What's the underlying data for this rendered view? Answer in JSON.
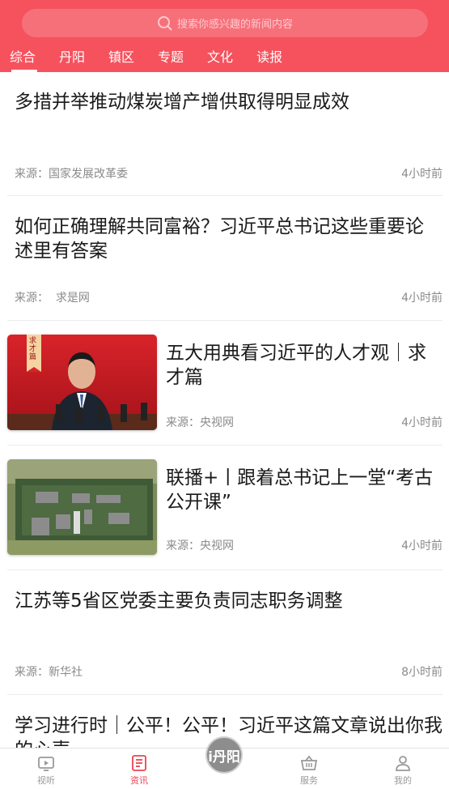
{
  "search": {
    "placeholder": "搜索你感兴趣的新闻内容"
  },
  "tabs": [
    {
      "label": "综合",
      "active": true
    },
    {
      "label": "丹阳"
    },
    {
      "label": "镇区"
    },
    {
      "label": "专题"
    },
    {
      "label": "文化"
    },
    {
      "label": "读报"
    }
  ],
  "articles": [
    {
      "title": "多措并举推动煤炭增产增供取得明显成效",
      "source": "来源：国家发展改革委",
      "time": "4小时前"
    },
    {
      "title": "如何正确理解共同富裕？习近平总书记这些重要论述里有答案",
      "source": "来源：  求是网",
      "time": "4小时前"
    },
    {
      "title": "五大用典看习近平的人才观｜求才篇",
      "source": "来源：央视网",
      "time": "4小时前",
      "thumb_caption": "求才篇"
    },
    {
      "title": "联播+丨跟着总书记上一堂“考古公开课”",
      "source": "来源：央视网",
      "time": "4小时前"
    },
    {
      "title": "江苏等5省区党委主要负责同志职务调整",
      "source": "来源：新华社",
      "time": "8小时前"
    },
    {
      "title": "学习进行时｜公平！公平！习近平这篇文章说出你我的心声"
    }
  ],
  "bottom_nav": {
    "items": [
      {
        "label": "视听",
        "icon": "tv-icon"
      },
      {
        "label": "资讯",
        "icon": "news-icon",
        "active": true
      },
      {
        "label": "服务",
        "icon": "basket-icon"
      },
      {
        "label": "我的",
        "icon": "user-icon"
      }
    ],
    "center_logo": "i丹阳"
  },
  "colors": {
    "brand": "#f5525d",
    "active_nav": "#e94451"
  }
}
